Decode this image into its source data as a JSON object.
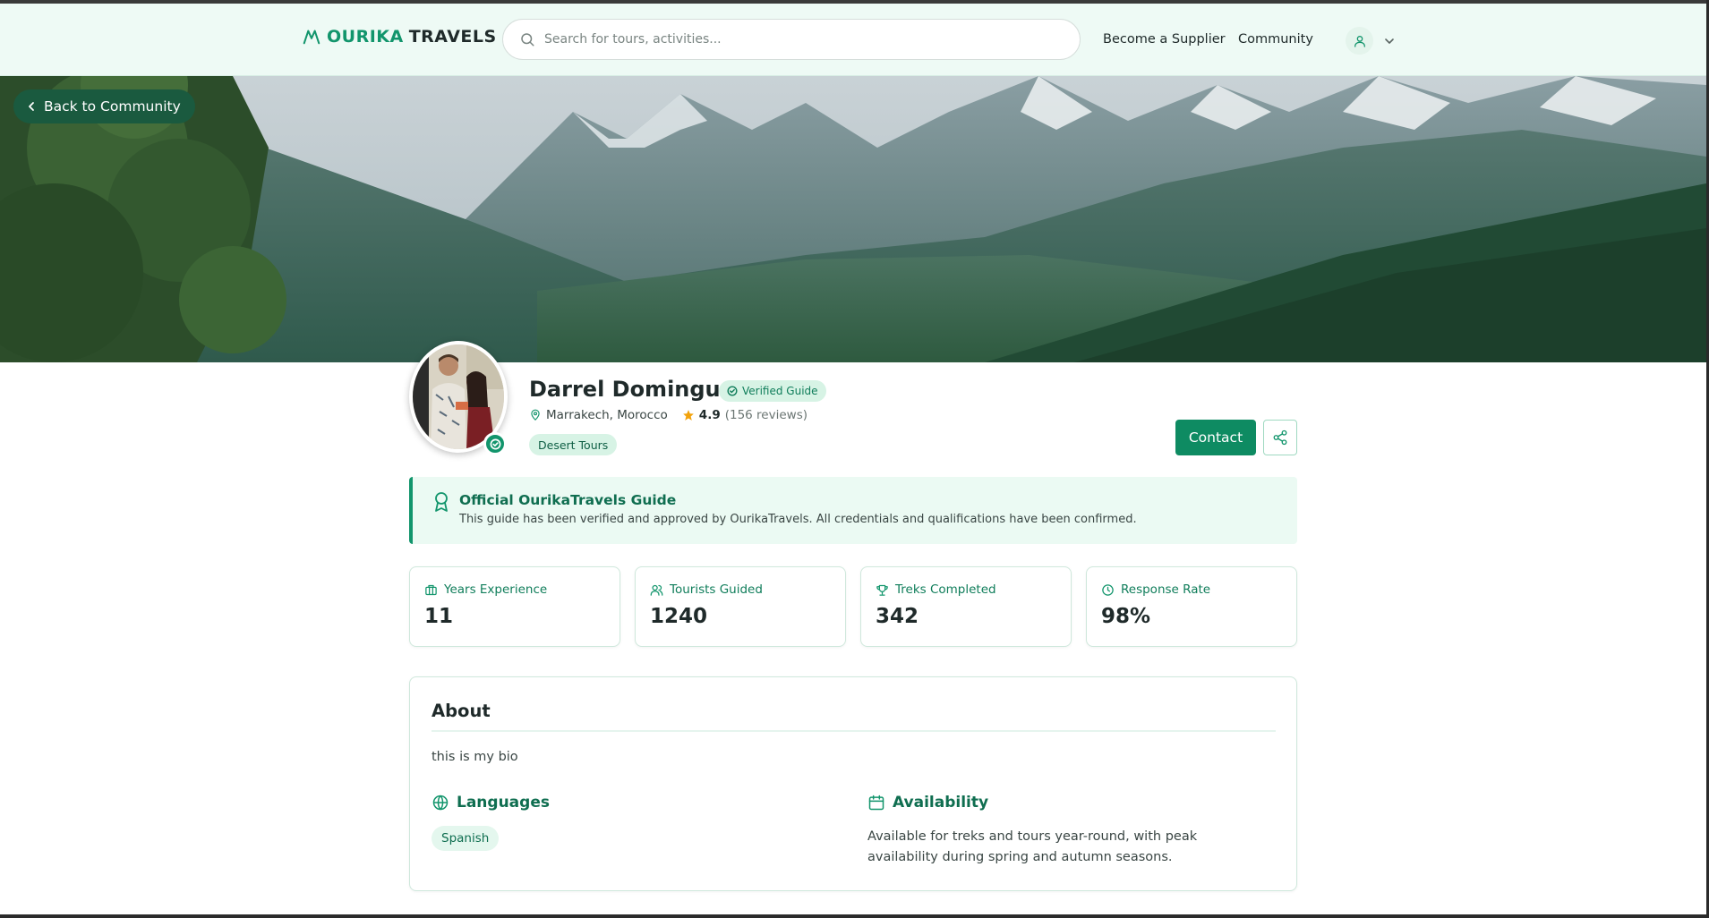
{
  "header": {
    "logo_word1": "OURIKA",
    "logo_word2": "TRAVELS",
    "search_placeholder": "Search for tours, activities...",
    "nav": [
      "Become a Supplier",
      "Community"
    ],
    "user_icon": "user-icon"
  },
  "hero": {
    "back_label": "Back to Community"
  },
  "profile": {
    "name": "Darrel Dominguez",
    "verified_label": "Verified Guide",
    "location": "Marrakech, Morocco",
    "rating": "4.9",
    "reviews": "(156 reviews)",
    "specialty": "Desert Tours",
    "contact_label": "Contact"
  },
  "official": {
    "title": "Official OurikaTravels Guide",
    "description": "This guide has been verified and approved by OurikaTravels. All credentials and qualifications have been confirmed."
  },
  "stats": [
    {
      "label": "Years Experience",
      "value": "11",
      "icon": "briefcase-icon"
    },
    {
      "label": "Tourists Guided",
      "value": "1240",
      "icon": "users-icon"
    },
    {
      "label": "Treks Completed",
      "value": "342",
      "icon": "trophy-icon"
    },
    {
      "label": "Response Rate",
      "value": "98%",
      "icon": "clock-icon"
    }
  ],
  "about": {
    "title": "About",
    "bio": "this is my bio",
    "languages_title": "Languages",
    "languages": [
      "Spanish"
    ],
    "availability_title": "Availability",
    "availability_text": "Available for treks and tours year-round, with peak availability during spring and autumn seasons."
  },
  "colors": {
    "brand": "#12956c",
    "brand_dark": "#0e8b62",
    "header_bg": "#eefaf5",
    "pill_bg": "#d7f3e5"
  }
}
